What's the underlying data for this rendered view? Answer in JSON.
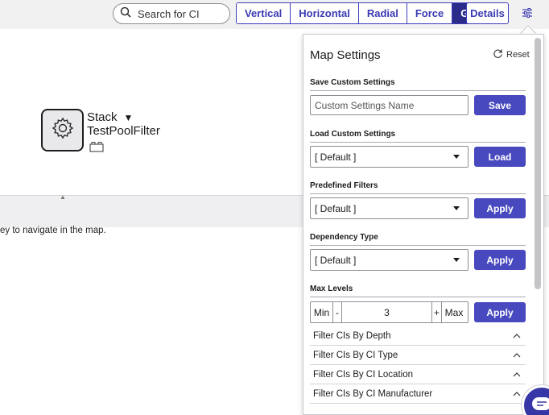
{
  "toolbar": {
    "search_placeholder": "Search for CI",
    "search_icon": "search-icon",
    "layouts": [
      "Vertical",
      "Horizontal",
      "Radial",
      "Force",
      "Group"
    ],
    "active_layout": "Group",
    "details_label": "Details",
    "settings_icon": "sliders-icon"
  },
  "map": {
    "node": {
      "icon": "gear-icon",
      "type": "Stack",
      "name": "TestPoolFilter",
      "badge_icon": "component-icon"
    },
    "hint": "ey to navigate in the map."
  },
  "panel": {
    "title": "Map Settings",
    "reset_label": "Reset",
    "save_section": {
      "label": "Save Custom Settings",
      "input_placeholder": "Custom Settings Name",
      "button": "Save"
    },
    "load_section": {
      "label": "Load Custom Settings",
      "selected": "[ Default ]",
      "button": "Load"
    },
    "predefined_section": {
      "label": "Predefined Filters",
      "selected": "[ Default ]",
      "button": "Apply"
    },
    "dependency_section": {
      "label": "Dependency Type",
      "selected": "[ Default ]",
      "button": "Apply"
    },
    "levels_section": {
      "label": "Max Levels",
      "min_label": "Min",
      "minus": "-",
      "value": "3",
      "plus": "+",
      "max_label": "Max",
      "button": "Apply"
    },
    "filters": [
      "Filter CIs By Depth",
      "Filter CIs By CI Type",
      "Filter CIs By CI Location",
      "Filter CIs By CI Manufacturer"
    ]
  },
  "colors": {
    "accent": "#4848bf",
    "active_tab": "#2b2b8a",
    "toolbar_bg": "#f1f1f1"
  }
}
